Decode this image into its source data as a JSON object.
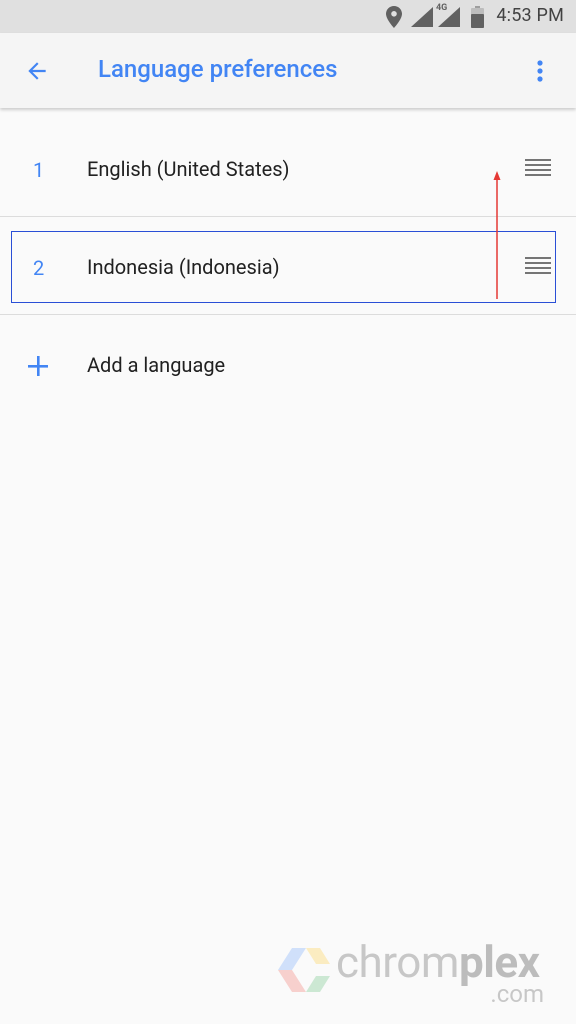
{
  "status_bar": {
    "time": "4:53 PM",
    "network_label": "4G",
    "icons": [
      "location-icon",
      "signal-icon",
      "signal-4g-icon",
      "battery-icon"
    ]
  },
  "app_bar": {
    "title": "Language preferences",
    "back_icon": "arrow-back-icon",
    "menu_icon": "more-vert-icon"
  },
  "languages": [
    {
      "number": "1",
      "name": "English (United States)",
      "handle_icon": "drag-handle-icon"
    },
    {
      "number": "2",
      "name": "Indonesia (Indonesia)",
      "handle_icon": "drag-handle-icon"
    }
  ],
  "add_language": {
    "label": "Add a language",
    "icon": "plus-icon"
  },
  "watermark": {
    "brand_light": "chrom",
    "brand_bold": "plex",
    "domain": ".com"
  },
  "colors": {
    "accent": "#4285f4",
    "selection_outline": "#2a4fd6",
    "drag_arrow": "#e53935",
    "background": "#fafafa",
    "text_primary": "#212121"
  }
}
